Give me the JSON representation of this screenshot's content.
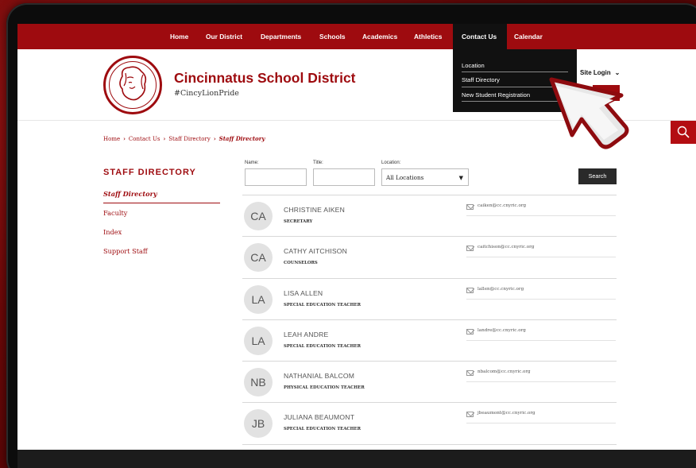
{
  "nav": {
    "items": [
      "Home",
      "Our District",
      "Departments",
      "Schools",
      "Academics",
      "Athletics",
      "Contact Us",
      "Calendar"
    ]
  },
  "dropdown": {
    "items": [
      "Location",
      "Staff Directory",
      "New Student Registration"
    ]
  },
  "header": {
    "title": "Cincinnatus School District",
    "tagline": "#CincyLionPride",
    "site_login": "Site Login",
    "logo_icon": "lion-logo-icon"
  },
  "breadcrumb": {
    "items": [
      "Home",
      "Contact Us",
      "Staff Directory",
      "Staff Directory"
    ]
  },
  "sidebar": {
    "title": "STAFF DIRECTORY",
    "items": [
      "Staff Directory",
      "Faculty",
      "Index",
      "Support Staff"
    ]
  },
  "filters": {
    "name_label": "Name:",
    "title_label": "Title:",
    "location_label": "Location:",
    "location_value": "All Locations",
    "search_label": "Search"
  },
  "staff": [
    {
      "initials": "CA",
      "name": "CHRISTINE AIKEN",
      "title": "SECRETARY",
      "email": "caiken@cc.cnyric.org"
    },
    {
      "initials": "CA",
      "name": "CATHY AITCHISON",
      "title": "COUNSELORS",
      "email": "caitchison@cc.cnyric.org"
    },
    {
      "initials": "LA",
      "name": "LISA ALLEN",
      "title": "SPECIAL EDUCATION TEACHER",
      "email": "lallen@cc.cnyric.org"
    },
    {
      "initials": "LA",
      "name": "LEAH ANDRE",
      "title": "SPECIAL EDUCATION TEACHER",
      "email": "landre@cc.cnyric.org"
    },
    {
      "initials": "NB",
      "name": "NATHANIAL BALCOM",
      "title": "PHYSICAL EDUCATION TEACHER",
      "email": "nbalcom@cc.cnyric.org"
    },
    {
      "initials": "JB",
      "name": "JULIANA BEAUMONT",
      "title": "SPECIAL EDUCATION TEACHER",
      "email": "jbeaumont@cc.cnyric.org"
    }
  ],
  "colors": {
    "brand_red": "#9e0b0f",
    "dark": "#111111"
  }
}
